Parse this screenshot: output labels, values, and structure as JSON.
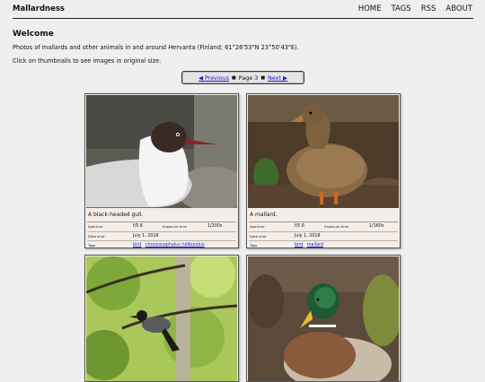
{
  "header": {
    "site_title": "Mallardness",
    "nav": [
      "HOME",
      "TAGS",
      "RSS",
      "ABOUT"
    ]
  },
  "intro": {
    "heading": "Welcome",
    "paragraph1": "Photos of mallards and other animals in and around Hervanta (Finland; 61°26'53\"N 23°50'43\"E).",
    "paragraph2": "Click on thumbnails to see images in original size."
  },
  "pager": {
    "prev": "◀ Previous",
    "page": "Page 3",
    "next": "Next ▶"
  },
  "meta_labels": {
    "aperture": "Aperture",
    "exposure": "Exposure time",
    "date": "Date shot",
    "tags": "Tags"
  },
  "cards": [
    {
      "caption": "A black-headed gull.",
      "aperture": "f/5.6",
      "exposure": "1/200s",
      "date": "July 1, 2018",
      "tags": [
        "bird",
        "chroicocephalus ridibundus"
      ]
    },
    {
      "caption": "A mallard.",
      "aperture": "f/5.6",
      "exposure": "1/160s",
      "date": "July 1, 2018",
      "tags": [
        "bird",
        "mallard"
      ]
    },
    {},
    {}
  ]
}
